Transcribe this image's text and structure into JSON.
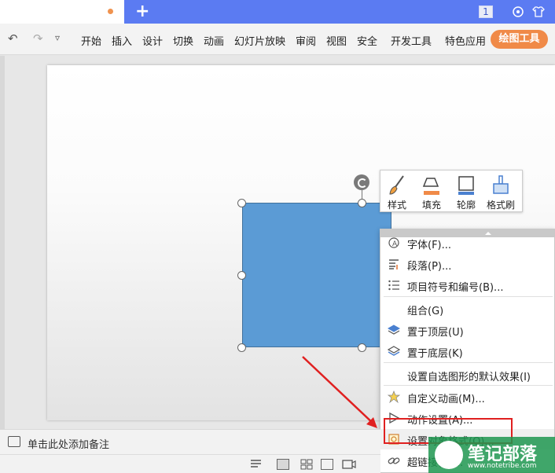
{
  "titlebar": {
    "new_tab": "+",
    "badge": "1"
  },
  "menubar": {
    "undo": "↶",
    "redo": "↷",
    "more": "▿",
    "items": [
      "开始",
      "插入",
      "设计",
      "切换",
      "动画",
      "幻灯片放映",
      "审阅",
      "视图",
      "安全",
      "开发工具",
      "特色应用"
    ],
    "drawing_tools": "绘图工具"
  },
  "floatbar": {
    "items": [
      {
        "label": "样式",
        "icon": "brush-icon"
      },
      {
        "label": "填充",
        "icon": "fill-bucket-icon"
      },
      {
        "label": "轮廓",
        "icon": "outline-icon"
      },
      {
        "label": "格式刷",
        "icon": "format-painter-icon"
      }
    ]
  },
  "context_menu": {
    "items": [
      {
        "label": "字体(F)...",
        "icon": "font-icon"
      },
      {
        "label": "段落(P)...",
        "icon": "paragraph-icon"
      },
      {
        "label": "项目符号和编号(B)...",
        "icon": "bullets-icon"
      },
      {
        "label": "组合(G)",
        "icon": ""
      },
      {
        "label": "置于顶层(U)",
        "icon": "bring-to-front-icon"
      },
      {
        "label": "置于底层(K)",
        "icon": "send-to-back-icon"
      },
      {
        "label": "设置自选图形的默认效果(I)",
        "icon": ""
      },
      {
        "label": "自定义动画(M)...",
        "icon": "custom-animation-icon"
      },
      {
        "label": "动作设置(A)...",
        "icon": "action-settings-icon"
      },
      {
        "label": "设置对象格式(O)...",
        "icon": "format-object-icon"
      },
      {
        "label": "超链接(H)...",
        "icon": "hyperlink-icon"
      }
    ]
  },
  "notes": {
    "placeholder": "单击此处添加备注"
  },
  "watermark": {
    "text": "笔记部落",
    "url": "www.notetribe.com"
  },
  "colors": {
    "accent_blue": "#5b7bf2",
    "drawing_tools_orange": "#f08a48",
    "shape_fill": "#5b9bd5",
    "highlight_red": "#e02020"
  }
}
